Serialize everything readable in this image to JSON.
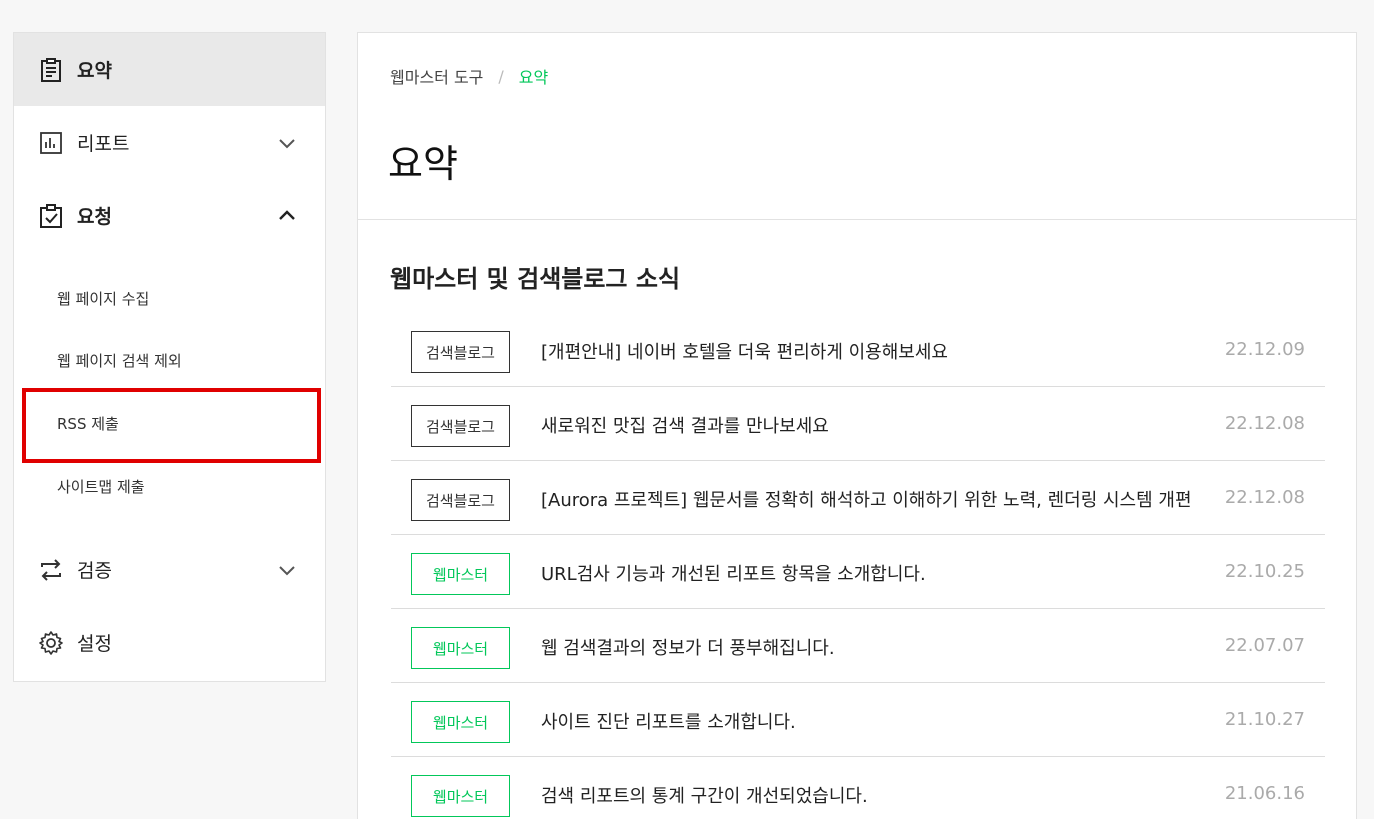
{
  "sidebar": {
    "items": [
      {
        "label": "요약",
        "icon": "clipboard-icon"
      },
      {
        "label": "리포트",
        "icon": "bar-chart-icon"
      },
      {
        "label": "요청",
        "icon": "clipboard-check-icon"
      },
      {
        "label": "검증",
        "icon": "swap-arrows-icon"
      },
      {
        "label": "설정",
        "icon": "gear-icon"
      }
    ],
    "sub_items": [
      {
        "label": "웹 페이지 수집"
      },
      {
        "label": "웹 페이지 검색 제외"
      },
      {
        "label": "RSS 제출"
      },
      {
        "label": "사이트맵 제출"
      }
    ]
  },
  "breadcrumb": {
    "root": "웹마스터 도구",
    "separator": "/",
    "current": "요약"
  },
  "page_title": "요약",
  "section_title": "웹마스터 및 검색블로그 소식",
  "news": [
    {
      "badge": "검색블로그",
      "title": "[개편안내] 네이버 호텔을 더욱 편리하게 이용해보세요",
      "date": "22.12.09"
    },
    {
      "badge": "검색블로그",
      "title": "새로워진 맛집 검색 결과를 만나보세요",
      "date": "22.12.08"
    },
    {
      "badge": "검색블로그",
      "title": "[Aurora 프로젝트] 웹문서를 정확히 해석하고 이해하기 위한 노력, 렌더링 시스템 개편",
      "date": "22.12.08"
    },
    {
      "badge": "웹마스터",
      "title": "URL검사 기능과 개선된 리포트 항목을 소개합니다.",
      "date": "22.10.25"
    },
    {
      "badge": "웹마스터",
      "title": "웹 검색결과의 정보가 더 풍부해집니다.",
      "date": "22.07.07"
    },
    {
      "badge": "웹마스터",
      "title": "사이트 진단 리포트를 소개합니다.",
      "date": "21.10.27"
    },
    {
      "badge": "웹마스터",
      "title": "검색 리포트의 통계 구간이 개선되었습니다.",
      "date": "21.06.16"
    }
  ],
  "colors": {
    "accent": "#03c75a",
    "highlight": "#e00000"
  }
}
